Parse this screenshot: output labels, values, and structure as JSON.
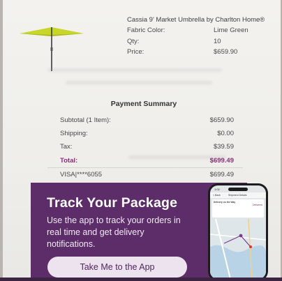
{
  "product": {
    "name": "Cassia 9' Market Umbrella by Charlton Home®",
    "details": [
      {
        "label": "Fabric Color:",
        "value": "Lime Green"
      },
      {
        "label": "Qty:",
        "value": "10"
      },
      {
        "label": "Price:",
        "value": "$659.90"
      }
    ],
    "canopy_color": "#c7d629"
  },
  "summary": {
    "title": "Payment Summary",
    "rows": [
      {
        "label": "Subtotal (1 Item):",
        "value": "$659.90",
        "emphasis": false
      },
      {
        "label": "Shipping:",
        "value": "$0.00",
        "emphasis": false
      },
      {
        "label": "Tax:",
        "value": "$39.59",
        "emphasis": false
      },
      {
        "label": "Total:",
        "value": "$699.49",
        "emphasis": true
      },
      {
        "label": "VISA|****6055",
        "value": "$699.49",
        "emphasis": false
      }
    ]
  },
  "promo": {
    "title": "Track Your Package",
    "body": "Use the app to track your orders in real time and get delivery notifications.",
    "button_label": "Take Me to the App",
    "background_color": "#5c2d69",
    "phone": {
      "status_time": "1:02",
      "nav_left": "< Back",
      "nav_title": "Shipment Details",
      "card_title": "Delivery on the Way",
      "card_status": "Delivered"
    }
  }
}
